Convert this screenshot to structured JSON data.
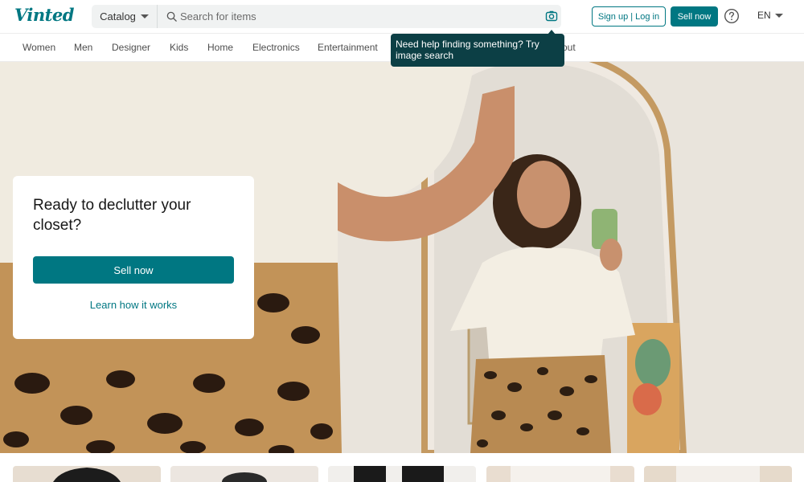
{
  "header": {
    "logo": "Vinted",
    "catalog_label": "Catalog",
    "search_placeholder": "Search for items",
    "signup_login_label": "Sign up | Log in",
    "sell_now_label": "Sell now",
    "language": "EN"
  },
  "nav": {
    "items": [
      "Women",
      "Men",
      "Designer",
      "Kids",
      "Home",
      "Electronics",
      "Entertainment",
      "out"
    ]
  },
  "tooltip": {
    "text": "Need help finding something? Try image search"
  },
  "hero": {
    "title": "Ready to declutter your closet?",
    "sell_now_label": "Sell now",
    "learn_label": "Learn how it works"
  },
  "colors": {
    "brand": "#007782",
    "tooltip_bg": "#0c3f45"
  },
  "icons": {
    "search": "search-icon",
    "camera": "camera-icon",
    "help": "help-icon"
  }
}
